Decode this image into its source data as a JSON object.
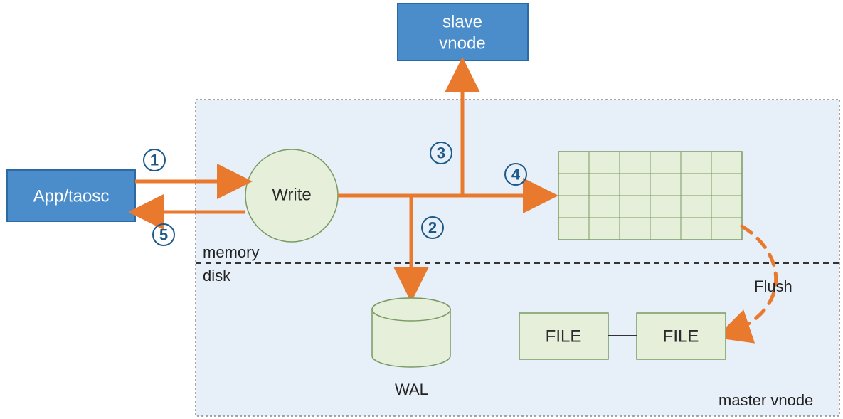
{
  "boxes": {
    "slave": {
      "line1": "slave",
      "line2": "vnode"
    },
    "app": {
      "label": "App/taosc"
    }
  },
  "write_circle": {
    "label": "Write"
  },
  "divider": {
    "above": "memory",
    "below": "disk"
  },
  "wal": {
    "label": "WAL"
  },
  "files": {
    "file1": "FILE",
    "file2": "FILE"
  },
  "flush": {
    "label": "Flush"
  },
  "master_label": "master vnode",
  "steps": {
    "s1": "1",
    "s2": "2",
    "s3": "3",
    "s4": "4",
    "s5": "5"
  }
}
